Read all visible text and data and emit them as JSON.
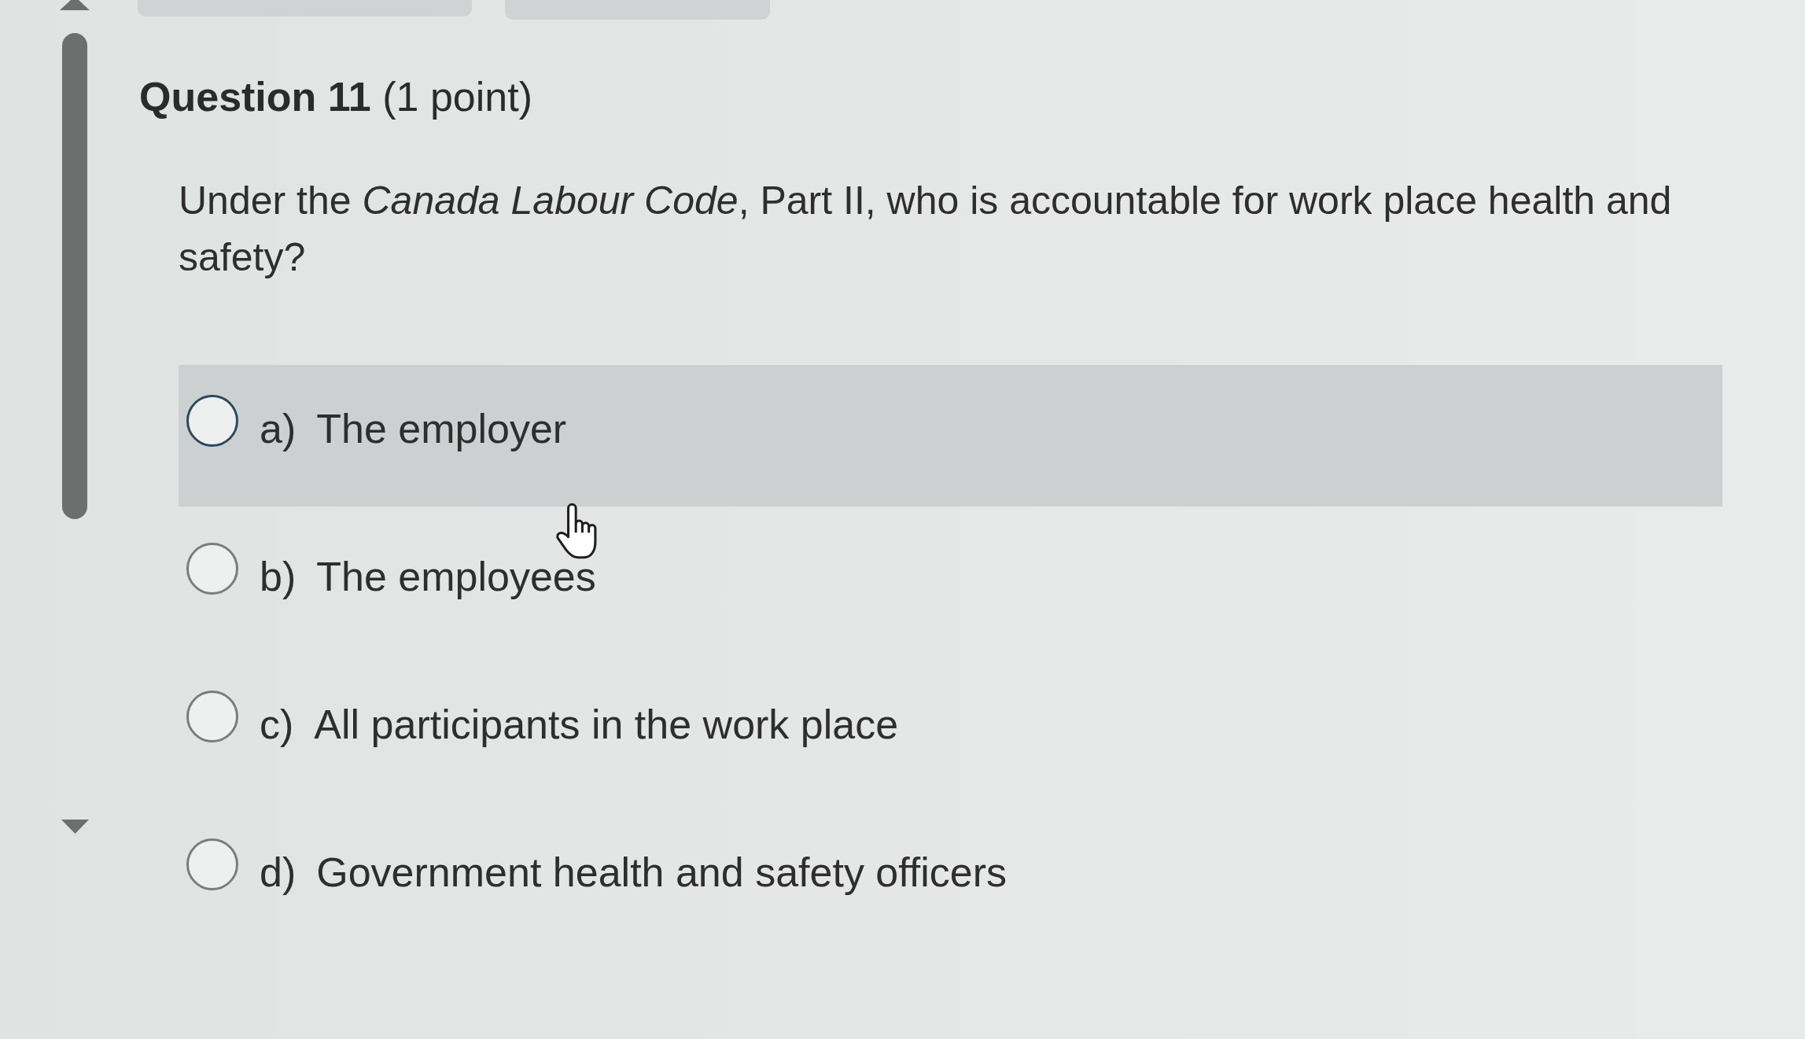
{
  "question": {
    "title": "**Question 11** (1 point)",
    "text": "Under the *Canada Labour Code*, Part II, who is accountable for work place health and safety?"
  },
  "options": [
    {
      "letter": "a)",
      "text": "The employer",
      "selected": false,
      "hovered": true
    },
    {
      "letter": "b)",
      "text": "The employees",
      "selected": false,
      "hovered": false
    },
    {
      "letter": "c)",
      "text": "All participants in the work place",
      "selected": false,
      "hovered": false
    },
    {
      "letter": "d)",
      "text": "Government health and safety officers",
      "selected": false,
      "hovered": false
    }
  ]
}
